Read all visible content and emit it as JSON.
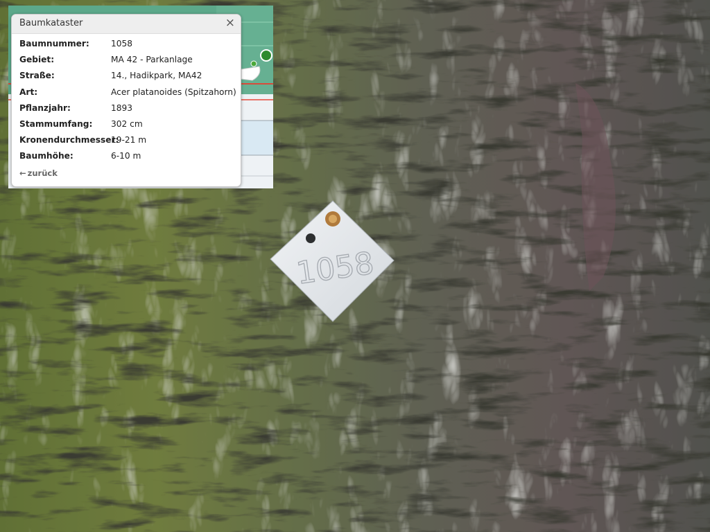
{
  "popup": {
    "title": "Baumkataster",
    "close_glyph": "×",
    "back_label": "zurück",
    "back_icon": "arrow-left-icon",
    "rows": [
      {
        "key": "Baumnummer:",
        "value": "1058"
      },
      {
        "key": "Gebiet:",
        "value": "MA 42 - Parkanlage"
      },
      {
        "key": "Straße:",
        "value": "14., Hadikpark, MA42"
      },
      {
        "key": "Art:",
        "value": "Acer platanoides (Spitzahorn)"
      },
      {
        "key": "Pflanzjahr:",
        "value": "1893"
      },
      {
        "key": "Stammumfang:",
        "value": "302 cm"
      },
      {
        "key": "Kronendurchmesser:",
        "value": "19-21 m"
      },
      {
        "key": "Baumhöhe:",
        "value": "6-10 m"
      }
    ]
  },
  "tag": {
    "number": "1058"
  },
  "colors": {
    "map_green": "#5ca88a",
    "marker_green": "#2e8b2e",
    "tag_metal": "#e2e5e8"
  }
}
